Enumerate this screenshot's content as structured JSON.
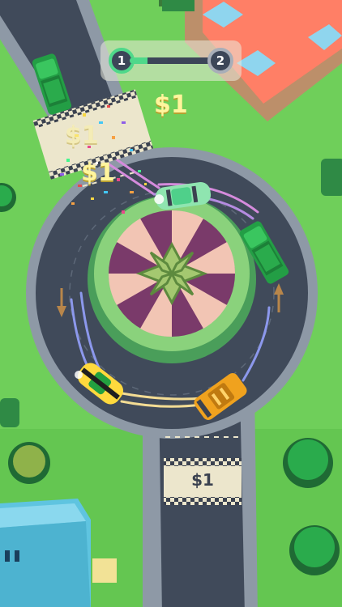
{
  "level": {
    "current": "1",
    "next": "2",
    "progress": 0.22
  },
  "floating_rewards": [
    "$1",
    "$1",
    "$1"
  ],
  "toll_booth": {
    "label": "$1"
  },
  "colors": {
    "grass": "#6fcf5a",
    "road": "#404a5a",
    "curb": "#8e99a6",
    "accent": "#4fd88a",
    "money": "#fff59d",
    "roof": "#ff7f66"
  }
}
